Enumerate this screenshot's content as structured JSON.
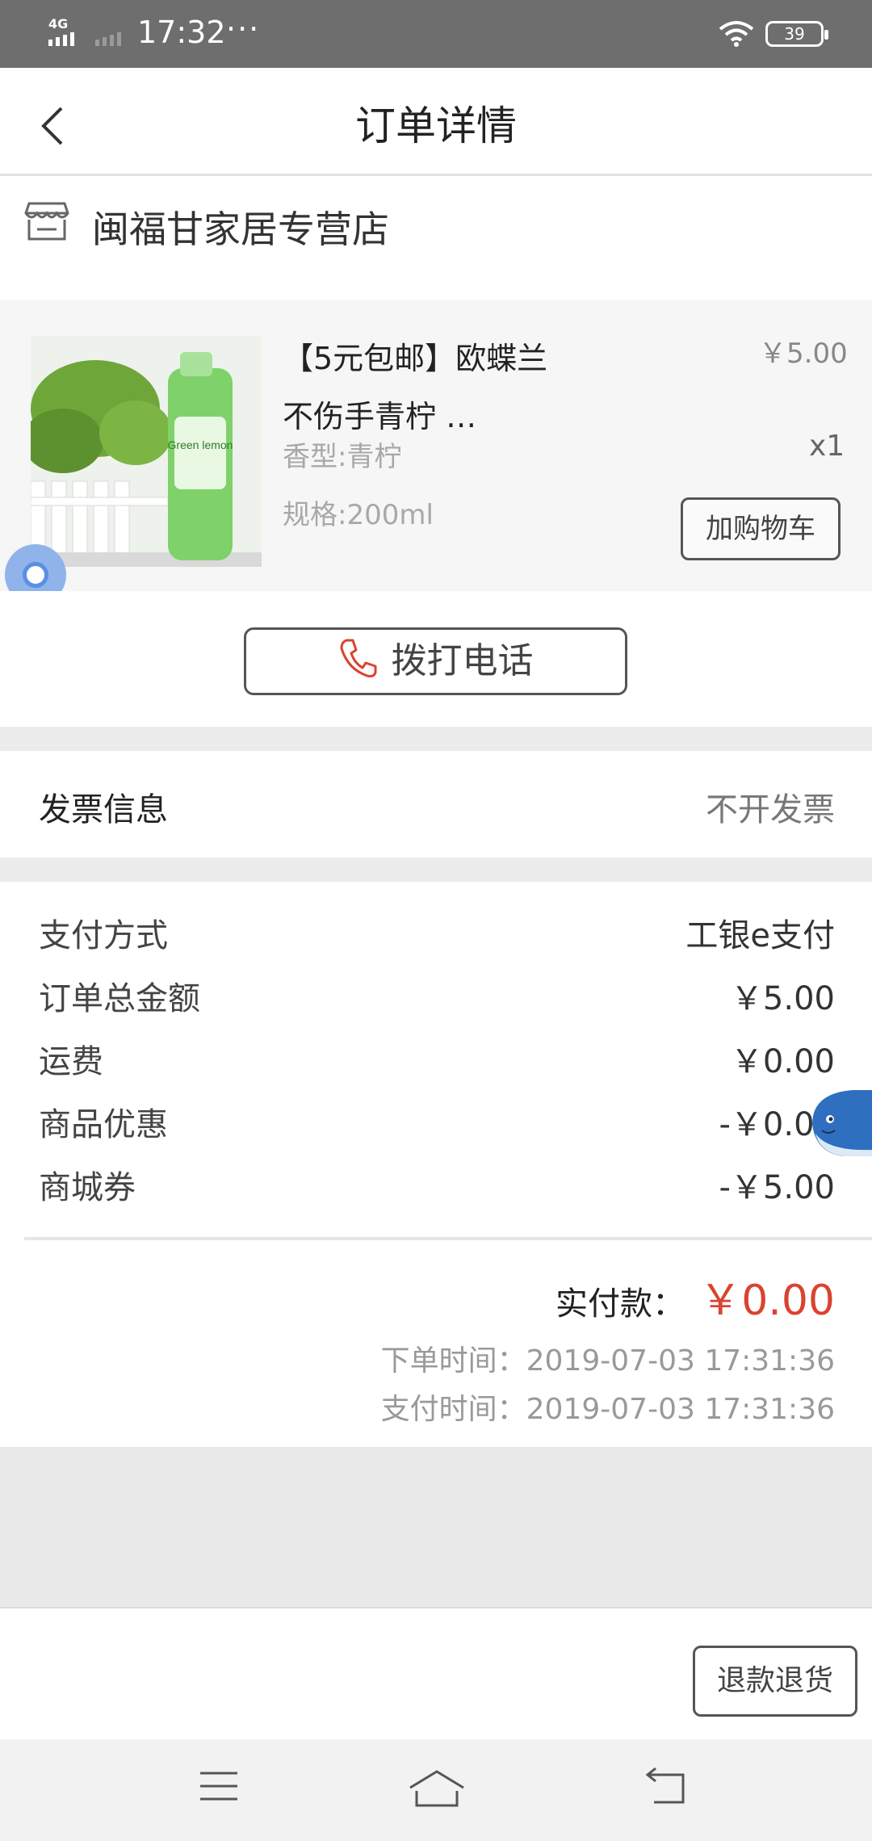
{
  "status_bar": {
    "network": "4G",
    "time": "17:32",
    "dots": "···",
    "battery": "39"
  },
  "header": {
    "title": "订单详情"
  },
  "store": {
    "name": "闽福甘家居专营店"
  },
  "product": {
    "title": "【5元包邮】欧蝶兰不伤手青柠 …",
    "price": "￥5.00",
    "attribute_scent": "香型:青柠",
    "quantity": "x1",
    "attribute_spec": "规格:200ml",
    "add_to_cart_label": "加购物车",
    "image_label": "Green lemon"
  },
  "call": {
    "label": "拨打电话"
  },
  "invoice": {
    "label": "发票信息",
    "value": "不开发票"
  },
  "payment": {
    "rows": [
      {
        "label": "支付方式",
        "value": "工银e支付"
      },
      {
        "label": "订单总金额",
        "value": "￥5.00"
      },
      {
        "label": "运费",
        "value": "￥0.00"
      },
      {
        "label": "商品优惠",
        "value": "-￥0.00"
      },
      {
        "label": "商城券",
        "value": "-￥5.00"
      }
    ],
    "total_label": "实付款：",
    "total_value": "￥0.00",
    "order_time": "下单时间：2019-07-03 17:31:36",
    "pay_time": "支付时间：2019-07-03 17:31:36"
  },
  "actions": {
    "refund_label": "退款退货"
  },
  "colors": {
    "accent_red": "#d9432f",
    "status_bar": "#6e6e6e",
    "section_gray": "#ececec"
  }
}
